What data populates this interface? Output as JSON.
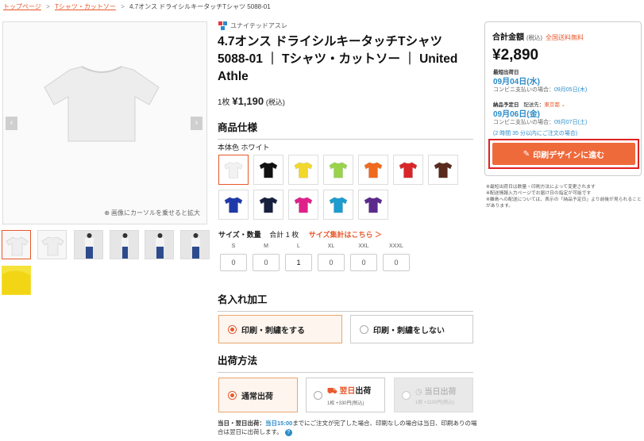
{
  "breadcrumb": {
    "home": "トップページ",
    "category": "Tシャツ・カットソー",
    "current": "4.7オンス ドライシルキータッチTシャツ 5088-01",
    "separator": ">"
  },
  "gallery": {
    "zoom_hint": "画像にカーソルを乗せると拡大",
    "prev": "‹",
    "next": "›"
  },
  "product": {
    "brand": "ユナイテッドアスレ",
    "title": "4.7オンス ドライシルキータッチTシャツ 5088-01 ｜ Tシャツ・カットソー ｜ United Athle",
    "unit_prefix": "1枚",
    "unit_price": "¥1,190",
    "unit_tax": "(税込)"
  },
  "spec": {
    "section_title": "商品仕様",
    "body_color_label": "本体色",
    "body_color_value": "ホワイト",
    "swatches": [
      {
        "name": "ホワイト",
        "color": "#f2f2f2"
      },
      {
        "name": "ブラック",
        "color": "#111111"
      },
      {
        "name": "イエロー",
        "color": "#f2d82a"
      },
      {
        "name": "ライムグリーン",
        "color": "#98d34a"
      },
      {
        "name": "オレンジ",
        "color": "#f06a1d"
      },
      {
        "name": "レッド",
        "color": "#d8262b"
      },
      {
        "name": "ブラウン",
        "color": "#5a2a1e"
      },
      {
        "name": "ロイヤルブルー",
        "color": "#1f3aa8"
      },
      {
        "name": "ネイビー",
        "color": "#17203f"
      },
      {
        "name": "ピンク",
        "color": "#e0208a"
      },
      {
        "name": "ターコイズ",
        "color": "#1d9ccf"
      },
      {
        "name": "パープル",
        "color": "#5b2a8c"
      }
    ]
  },
  "sizes": {
    "label": "サイズ・数量",
    "total": "合計 1 枚",
    "link": "サイズ集計はこちら ＞",
    "columns": [
      {
        "label": "S",
        "qty": "0"
      },
      {
        "label": "M",
        "qty": "0"
      },
      {
        "label": "L",
        "qty": "1"
      },
      {
        "label": "XL",
        "qty": "0"
      },
      {
        "label": "XXL",
        "qty": "0"
      },
      {
        "label": "XXXL",
        "qty": "0"
      }
    ]
  },
  "printing": {
    "section_title": "名入れ加工",
    "option_print": "印刷・刺繍をする",
    "option_noprint": "印刷・刺繍をしない"
  },
  "shipping": {
    "section_title": "出荷方法",
    "normal": "通常出荷",
    "nextday": "翌日",
    "nextday_suffix": "出荷",
    "nextday_price": "1枚 +330円(税込)",
    "sameday": "当日出荷",
    "sameday_price": "1枚 +1100円(税込)",
    "note_prefix": "当日・翌日出荷：",
    "note_time": "当日15:00",
    "note_rest": "までにご注文が完了した場合、印刷なしの場合は当日、印刷ありの場合は翌日に出荷します。",
    "help": "?"
  },
  "summary": {
    "total_label": "合計金額",
    "total_tax": "(税込)",
    "free_shipping": "全国送料無料",
    "total": "¥2,890",
    "ship_label": "最短出荷日",
    "ship_date": "09月04日(水)",
    "ship_conv": "コンビニ支払いの場合：",
    "ship_conv_date": "09月05日(木)",
    "deliver_label": "納品予定日",
    "deliver_to": "配送先：",
    "deliver_region": "東京都 ⌄",
    "deliver_date": "09月06日(金)",
    "deliver_conv": "コンビニ支払いの場合：",
    "deliver_conv_date": "09月07日(土)",
    "countdown": "(2 時間 35 分以内にご注文の場合)",
    "cta": "印刷デザインに進む",
    "notes": [
      "※最短出荷日は数量・印刷方法によって変更されます",
      "※配送情報入力ページでお届け日の指定が可能です",
      "※離島への配送については、表示の「納品予定日」より前後が見られることがあります。"
    ]
  },
  "colors": {
    "accent": "#e8582b",
    "link_blue": "#2a8bc9",
    "cta_bg": "#ef6a3b",
    "highlight_frame": "#e02020"
  }
}
